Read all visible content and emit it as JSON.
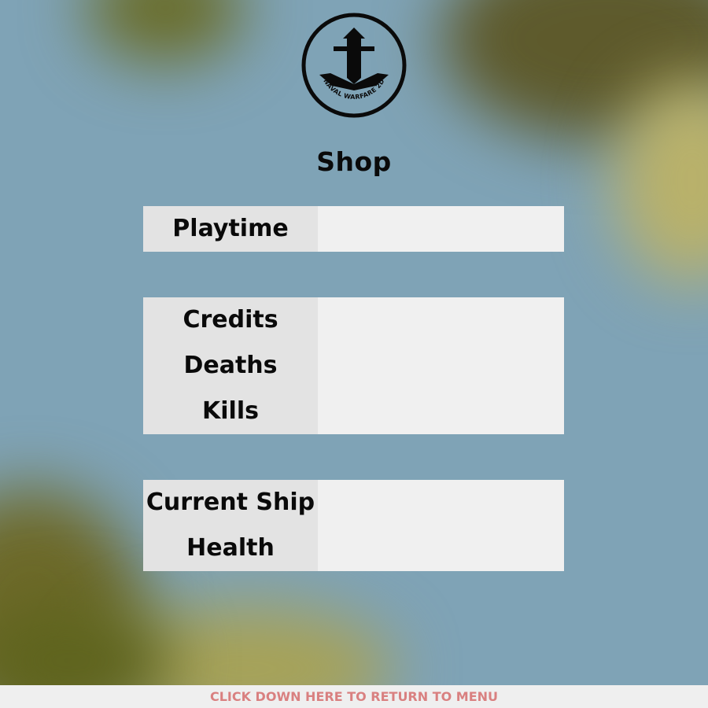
{
  "logo": {
    "text": "NAVAL WARFARE 2D"
  },
  "title": "Shop",
  "playtime": {
    "label": "Playtime",
    "value": ""
  },
  "stats": {
    "credits": {
      "label": "Credits",
      "value": ""
    },
    "deaths": {
      "label": "Deaths",
      "value": ""
    },
    "kills": {
      "label": "Kills",
      "value": ""
    }
  },
  "ship": {
    "current_ship": {
      "label": "Current Ship",
      "value": ""
    },
    "health": {
      "label": "Health",
      "value": ""
    }
  },
  "footer": {
    "text": "CLICK DOWN HERE TO RETURN TO MENU"
  },
  "colors": {
    "water": "#7fa3b6",
    "land": "#6b6a2a",
    "panel_label_bg": "#e3e3e3",
    "panel_value_bg": "#f0f0f0",
    "footer_text": "#d98080"
  }
}
